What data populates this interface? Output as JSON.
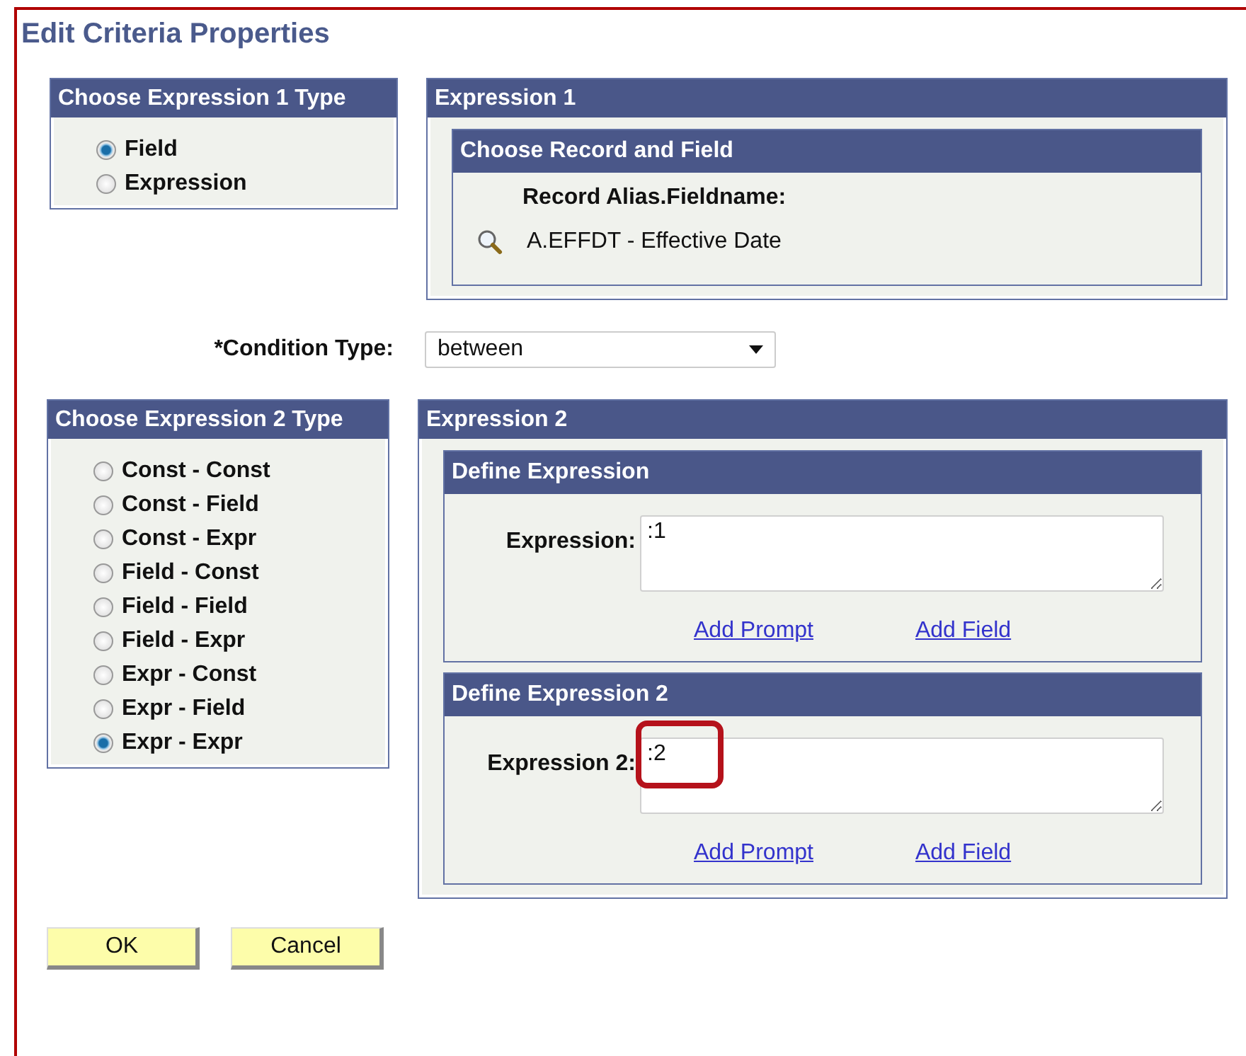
{
  "title": "Edit Criteria Properties",
  "expression1_type": {
    "heading": "Choose Expression 1 Type",
    "options": [
      {
        "label": "Field",
        "selected": true
      },
      {
        "label": "Expression",
        "selected": false
      }
    ]
  },
  "expression1": {
    "heading": "Expression 1",
    "section": {
      "heading": "Choose Record and Field",
      "label": "Record Alias.Fieldname:",
      "value": "A.EFFDT - Effective Date"
    }
  },
  "condition_type": {
    "label": "*Condition Type:",
    "value": "between"
  },
  "expression2_type": {
    "heading": "Choose Expression 2 Type",
    "options": [
      {
        "label": "Const - Const",
        "selected": false
      },
      {
        "label": "Const - Field",
        "selected": false
      },
      {
        "label": "Const - Expr",
        "selected": false
      },
      {
        "label": "Field - Const",
        "selected": false
      },
      {
        "label": "Field - Field",
        "selected": false
      },
      {
        "label": "Field - Expr",
        "selected": false
      },
      {
        "label": "Expr - Const",
        "selected": false
      },
      {
        "label": "Expr - Field",
        "selected": false
      },
      {
        "label": "Expr - Expr",
        "selected": true
      }
    ]
  },
  "expression2": {
    "heading": "Expression 2",
    "sections": [
      {
        "heading": "Define Expression",
        "label": "Expression:",
        "value": ":1",
        "highlighted": false,
        "links": [
          "Add Prompt",
          "Add Field"
        ]
      },
      {
        "heading": "Define Expression 2",
        "label": "Expression 2:",
        "value": ":2",
        "highlighted": true,
        "links": [
          "Add Prompt",
          "Add Field"
        ]
      }
    ]
  },
  "buttons": [
    "OK",
    "Cancel"
  ]
}
